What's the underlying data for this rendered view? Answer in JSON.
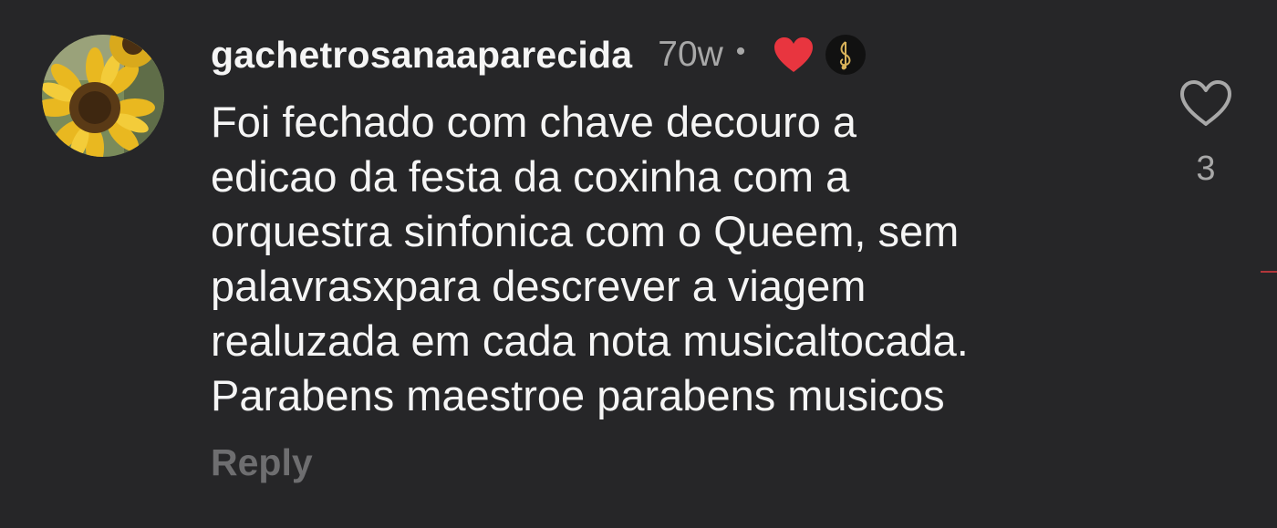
{
  "comment": {
    "username": "gachetrosanaaparecida",
    "time": "70w",
    "separator": "•",
    "avatar_icon": "sunflower-avatar",
    "creator_liked_icon": "red-heart-icon",
    "creator_avatar_icon": "music-note-avatar",
    "text_lines": [
      "Foi fechado com chave decouro a",
      "edicao da festa da coxinha com a",
      "orquestra sinfonica com o Queem, sem",
      "palavrasxpara descrever a viagem",
      "realuzada em cada nota musicaltocada.",
      "Parabens maestroe parabens musicos"
    ],
    "reply_label": "Reply",
    "like_icon": "heart-outline-icon",
    "like_count": "3"
  },
  "colors": {
    "background": "#262628",
    "text": "#f5f5f5",
    "muted": "#a8a8a8",
    "reply": "#6e6e70",
    "heart": "#e8353f"
  }
}
